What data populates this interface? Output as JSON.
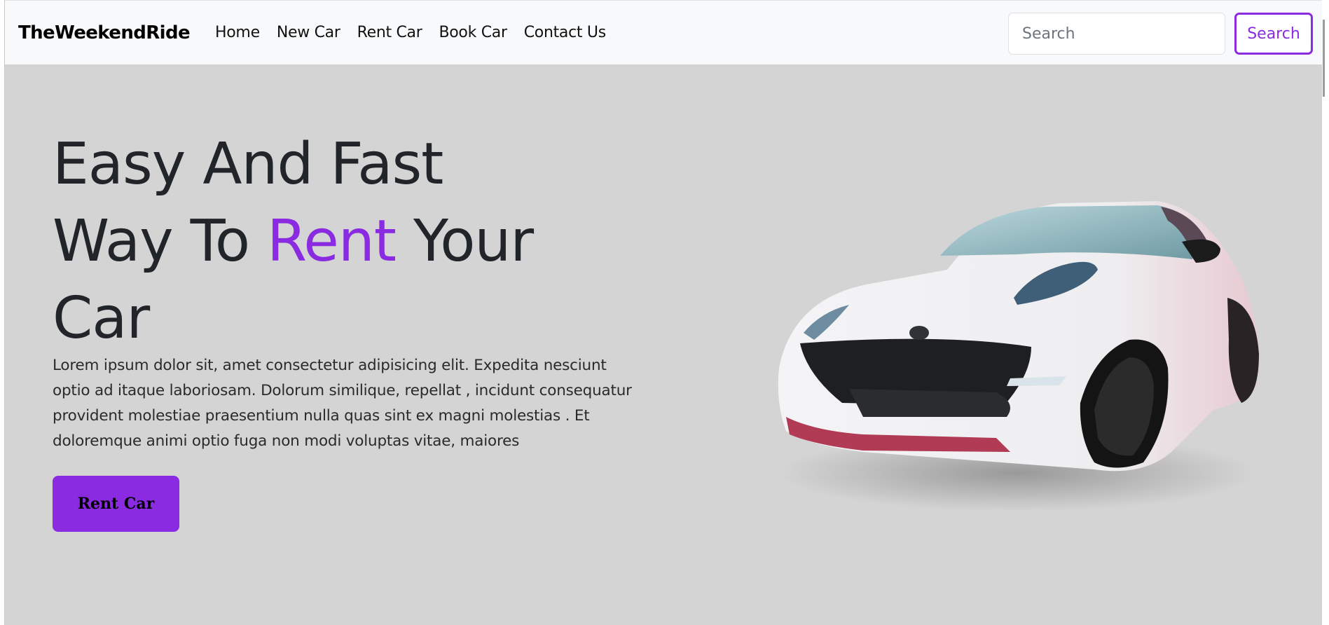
{
  "navbar": {
    "brand": "TheWeekendRide",
    "links": [
      "Home",
      "New Car",
      "Rent Car",
      "Book Car",
      "Contact Us"
    ],
    "search_placeholder": "Search",
    "search_button": "Search"
  },
  "hero": {
    "title_line1": "Easy And Fast",
    "title_line2_before": "Way To ",
    "title_accent": "Rent",
    "title_line2_after": " Your",
    "title_line3": "Car",
    "paragraph_lines": [
      "Lorem ipsum dolor sit, amet consectetur adipisicing elit. Expedita nesciunt",
      "optio ad itaque laboriosam. Dolorum similique, repellat , incidunt consequatur",
      "provident molestiae praesentium nulla quas sint ex magni molestias . Et",
      "doloremque animi optio fuga non modi voluptas vitae, maiores"
    ],
    "cta_label": "Rent Car",
    "image": "white-sports-car"
  },
  "colors": {
    "accent": "#8a2be2",
    "hero_bg": "#d4d4d4",
    "navbar_bg": "#f8f9fa",
    "text": "#212529"
  }
}
